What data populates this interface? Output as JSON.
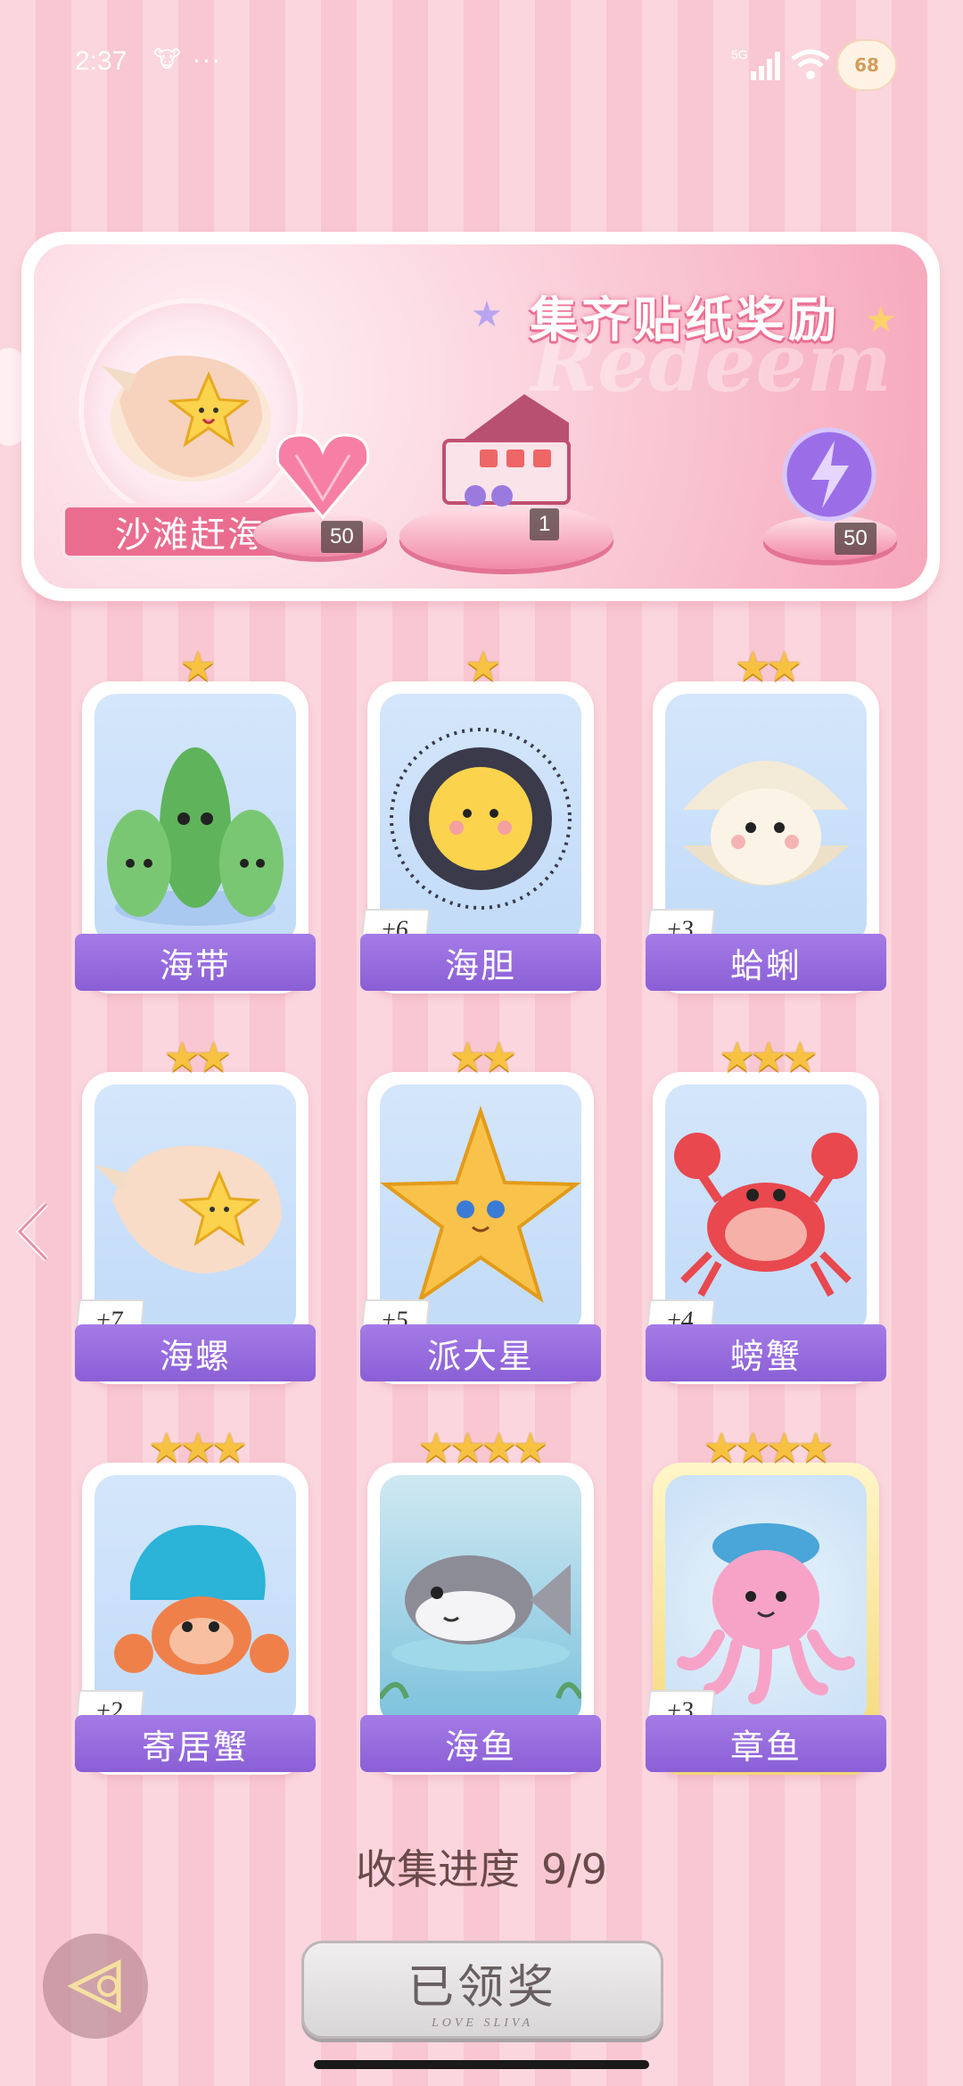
{
  "status_bar": {
    "time": "2:37",
    "dots": "···",
    "network": "5G",
    "battery": "68"
  },
  "banner": {
    "title": "集齐贴纸奖励",
    "watermark": "Redeem",
    "event_name": "沙滩赶海",
    "rewards": [
      {
        "icon": "pink-diamond-icon",
        "count": "50"
      },
      {
        "icon": "gift-box-icon",
        "count": "1"
      },
      {
        "icon": "energy-orb-icon",
        "count": "50"
      }
    ]
  },
  "cards": [
    {
      "name": "海带",
      "stars": "★",
      "count": ""
    },
    {
      "name": "海胆",
      "stars": "★",
      "count": "+6"
    },
    {
      "name": "蛤蜊",
      "stars": "★★",
      "count": "+3"
    },
    {
      "name": "海螺",
      "stars": "★★",
      "count": "+7"
    },
    {
      "name": "派大星",
      "stars": "★★",
      "count": "+5"
    },
    {
      "name": "螃蟹",
      "stars": "★★★",
      "count": "+4"
    },
    {
      "name": "寄居蟹",
      "stars": "★★★",
      "count": "+2"
    },
    {
      "name": "海鱼",
      "stars": "★★★★",
      "count": ""
    },
    {
      "name": "章鱼",
      "stars": "★★★★",
      "count": "+3"
    }
  ],
  "progress": {
    "label": "收集进度",
    "value": "9/9"
  },
  "claim_button": {
    "label": "已领奖",
    "sub": "LOVE SLIVA"
  },
  "colors": {
    "accent_purple": "#8a5fd6",
    "ribbon_pink": "#ea6d8f",
    "star_gold": "#f7c241"
  }
}
